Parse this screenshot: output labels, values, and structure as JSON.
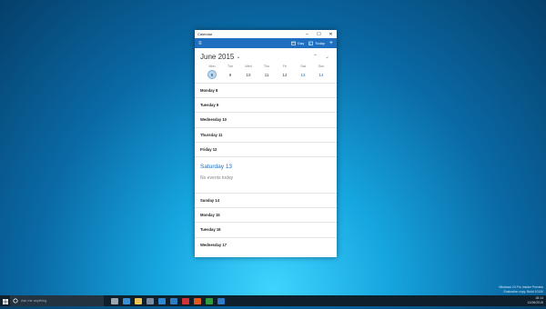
{
  "window": {
    "title": "Calendar",
    "controls": {
      "minimize": "–",
      "maximize": "☐",
      "close": "✕"
    }
  },
  "appbar": {
    "menu_icon": "hamburger-icon",
    "day_label": "Day",
    "today_label": "Today",
    "add_label": "+"
  },
  "calendar": {
    "month_label": "June 2015",
    "week": [
      {
        "name": "Mon",
        "num": "8",
        "today": true,
        "weekend": false
      },
      {
        "name": "Tue",
        "num": "9",
        "today": false,
        "weekend": false
      },
      {
        "name": "Wed",
        "num": "10",
        "today": false,
        "weekend": false
      },
      {
        "name": "Thu",
        "num": "11",
        "today": false,
        "weekend": false
      },
      {
        "name": "Fri",
        "num": "12",
        "today": false,
        "weekend": false
      },
      {
        "name": "Sat",
        "num": "13",
        "today": false,
        "weekend": true
      },
      {
        "name": "Sun",
        "num": "14",
        "today": false,
        "weekend": true
      }
    ],
    "agenda_before": [
      "Monday 8",
      "Tuesday 9",
      "Wednesday 10",
      "Thursday 11",
      "Friday 12"
    ],
    "highlight": {
      "day": "Saturday 13",
      "note": "No events today"
    },
    "agenda_after": [
      "Sunday 14",
      "Monday 15",
      "Tuesday 16",
      "Wednesday 17"
    ]
  },
  "colors": {
    "accent": "#1e6fbf",
    "taskbar": "#0f1f2c"
  },
  "taskbar": {
    "search_placeholder": "Ask me anything",
    "icons": [
      {
        "name": "task-view-icon",
        "color": "#9aa6b0"
      },
      {
        "name": "edge-icon",
        "color": "#3b8fd6"
      },
      {
        "name": "file-explorer-icon",
        "color": "#e8c25a"
      },
      {
        "name": "store-icon",
        "color": "#7a8aa0"
      },
      {
        "name": "mail-icon",
        "color": "#2f86d0"
      },
      {
        "name": "photos-icon",
        "color": "#2c7fc4"
      },
      {
        "name": "onenote-icon",
        "color": "#d13438"
      },
      {
        "name": "office-icon",
        "color": "#e05a1f"
      },
      {
        "name": "xbox-icon",
        "color": "#2f9d39"
      },
      {
        "name": "calendar-app-icon",
        "color": "#2f79c9"
      }
    ],
    "time": "18:14",
    "date": "12/06/2015"
  },
  "watermark": {
    "line1": "Windows 10 Pro Insider Preview",
    "line2": "Evaluation copy. Build 10130"
  }
}
